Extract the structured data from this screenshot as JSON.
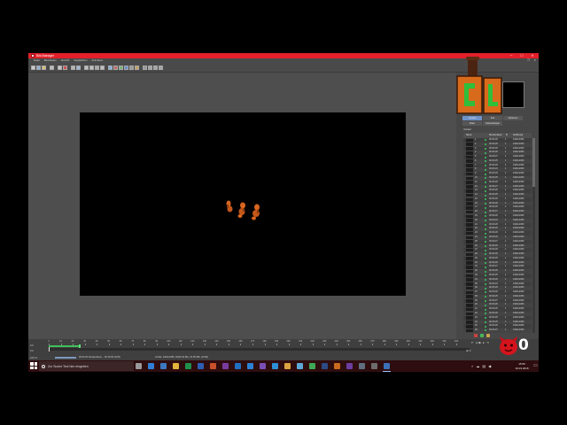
{
  "colors": {
    "titlebar": "#e3202a",
    "taskbar": "#2e0d0e",
    "active_tab": "#6f93c9",
    "status_ok": "#3ccb5c",
    "rendered_range": "#3fbf5a",
    "render_figure": "#d9661f"
  },
  "window": {
    "title": "Bild-Manager",
    "app_icon": "picture-viewer-icon",
    "minimize_glyph": "─",
    "maximize_glyph": "☐",
    "close_glyph": "✕"
  },
  "menu": {
    "items": [
      "Datei",
      "Bearbeiten",
      "Ansicht",
      "Vergleichen",
      "Animation"
    ],
    "restore_glyph": "❐",
    "close_glyph": "✕"
  },
  "toolbar": {
    "groups": [
      [
        {
          "name": "open-icon",
          "color": "#c9c9c9"
        },
        {
          "name": "save-icon",
          "color": "#8fb1d8"
        },
        {
          "name": "save-as-icon",
          "color": "#d8c27a"
        }
      ],
      [
        {
          "name": "info-icon",
          "color": "#bfbfbf"
        }
      ],
      [
        {
          "name": "copy-icon",
          "color": "#c6c6c6"
        },
        {
          "name": "stop-render-icon",
          "color": "#d05050"
        }
      ],
      [
        {
          "name": "zoom-fit-icon",
          "color": "#b5b5b5"
        },
        {
          "name": "zoom-100-icon",
          "color": "#9fb6d6"
        }
      ],
      [
        {
          "name": "compare-a-icon",
          "color": "#c0c0c0"
        },
        {
          "name": "compare-b-icon",
          "color": "#c0c0c0"
        },
        {
          "name": "swap-ab-icon",
          "color": "#a9a9a9"
        },
        {
          "name": "compare-split-icon",
          "color": "#c0c0c0"
        }
      ],
      [
        {
          "name": "rgb-icon",
          "color": "#7fb0e0"
        },
        {
          "name": "red-channel-icon",
          "color": "#c46a6a"
        },
        {
          "name": "green-channel-icon",
          "color": "#79b37a"
        },
        {
          "name": "blue-channel-icon",
          "color": "#6c8fc9"
        },
        {
          "name": "alpha-channel-icon",
          "color": "#9a9a9a"
        },
        {
          "name": "filter-icon",
          "color": "#c4a15e"
        }
      ],
      [
        {
          "name": "grid-icon",
          "color": "#9a9a9a"
        },
        {
          "name": "stereo-icon",
          "color": "#a5a5a5"
        },
        {
          "name": "histogram-icon",
          "color": "#a5a5a5"
        },
        {
          "name": "lut-icon",
          "color": "#a5a5a5"
        }
      ]
    ]
  },
  "panel": {
    "tabs_row1": [
      {
        "label": "Verlauf",
        "active": true
      },
      {
        "label": "Info"
      },
      {
        "label": "Optionen"
      }
    ],
    "tabs_row2": [
      {
        "label": "Filter"
      },
      {
        "label": "Stereoskopie"
      }
    ],
    "section_label": "Verlauf",
    "columns": {
      "name": "Name",
      "render_time": "Renderdauer",
      "b": "B",
      "resolution": "Auflösung"
    },
    "rows": [
      {
        "name": "1",
        "time": "00:00:26",
        "b": "1",
        "resolution": "1920x1080"
      },
      {
        "name": "2",
        "time": "00:00:25",
        "b": "1",
        "resolution": "1920x1080"
      },
      {
        "name": "3",
        "time": "00:00:26",
        "b": "1",
        "resolution": "1920x1080"
      },
      {
        "name": "4",
        "time": "00:00:26",
        "b": "1",
        "resolution": "1920x1080"
      },
      {
        "name": "5",
        "time": "00:00:27",
        "b": "1",
        "resolution": "1920x1080"
      },
      {
        "name": "6",
        "time": "00:00:25",
        "b": "1",
        "resolution": "1920x1080"
      },
      {
        "name": "7",
        "time": "00:00:26",
        "b": "1",
        "resolution": "1920x1080"
      },
      {
        "name": "8",
        "time": "00:00:24",
        "b": "1",
        "resolution": "1920x1080"
      },
      {
        "name": "9",
        "time": "00:00:26",
        "b": "1",
        "resolution": "1920x1080"
      },
      {
        "name": "10",
        "time": "00:00:25",
        "b": "1",
        "resolution": "1920x1080"
      },
      {
        "name": "11",
        "time": "00:00:26",
        "b": "1",
        "resolution": "1920x1080"
      },
      {
        "name": "12",
        "time": "00:00:27",
        "b": "1",
        "resolution": "1920x1080"
      },
      {
        "name": "13",
        "time": "00:00:26",
        "b": "1",
        "resolution": "1920x1080"
      },
      {
        "name": "14",
        "time": "00:00:25",
        "b": "1",
        "resolution": "1920x1080"
      },
      {
        "name": "15",
        "time": "00:00:26",
        "b": "1",
        "resolution": "1920x1080"
      },
      {
        "name": "16",
        "time": "00:00:26",
        "b": "1",
        "resolution": "1920x1080"
      },
      {
        "name": "17",
        "time": "00:00:25",
        "b": "1",
        "resolution": "1920x1080"
      },
      {
        "name": "18",
        "time": "00:00:27",
        "b": "1",
        "resolution": "1920x1080"
      },
      {
        "name": "19",
        "time": "00:00:26",
        "b": "1",
        "resolution": "1920x1080"
      },
      {
        "name": "20",
        "time": "00:00:24",
        "b": "1",
        "resolution": "1920x1080"
      },
      {
        "name": "21",
        "time": "00:00:26",
        "b": "1",
        "resolution": "1920x1080"
      },
      {
        "name": "22",
        "time": "00:00:25",
        "b": "1",
        "resolution": "1920x1080"
      },
      {
        "name": "23",
        "time": "00:00:26",
        "b": "1",
        "resolution": "1920x1080"
      },
      {
        "name": "24",
        "time": "00:00:26",
        "b": "1",
        "resolution": "1920x1080"
      },
      {
        "name": "25",
        "time": "00:00:27",
        "b": "1",
        "resolution": "1920x1080"
      },
      {
        "name": "26",
        "time": "00:00:25",
        "b": "1",
        "resolution": "1920x1080"
      },
      {
        "name": "27",
        "time": "00:00:26",
        "b": "1",
        "resolution": "1920x1080"
      },
      {
        "name": "28",
        "time": "00:00:26",
        "b": "1",
        "resolution": "1920x1080"
      },
      {
        "name": "29",
        "time": "00:00:25",
        "b": "1",
        "resolution": "1920x1080"
      },
      {
        "name": "30",
        "time": "00:00:26",
        "b": "1",
        "resolution": "1920x1080"
      },
      {
        "name": "31",
        "time": "00:00:27",
        "b": "1",
        "resolution": "1920x1080"
      },
      {
        "name": "32",
        "time": "00:00:26",
        "b": "1",
        "resolution": "1920x1080"
      },
      {
        "name": "33",
        "time": "00:00:25",
        "b": "1",
        "resolution": "1920x1080"
      },
      {
        "name": "34",
        "time": "00:00:26",
        "b": "1",
        "resolution": "1920x1080"
      },
      {
        "name": "35",
        "time": "00:00:24",
        "b": "1",
        "resolution": "1920x1080"
      },
      {
        "name": "36",
        "time": "00:00:26",
        "b": "1",
        "resolution": "1920x1080"
      },
      {
        "name": "37",
        "time": "00:00:26",
        "b": "1",
        "resolution": "1920x1080"
      },
      {
        "name": "38",
        "time": "00:00:25",
        "b": "1",
        "resolution": "1920x1080"
      },
      {
        "name": "39",
        "time": "00:00:27",
        "b": "1",
        "resolution": "1920x1080"
      },
      {
        "name": "40",
        "time": "00:00:26",
        "b": "1",
        "resolution": "1920x1080"
      },
      {
        "name": "41",
        "time": "00:00:25",
        "b": "1",
        "resolution": "1920x1080"
      },
      {
        "name": "42",
        "time": "00:00:26",
        "b": "1",
        "resolution": "1920x1080"
      },
      {
        "name": "43",
        "time": "00:00:26",
        "b": "1",
        "resolution": "1920x1080"
      },
      {
        "name": "44",
        "time": "00:00:25",
        "b": "1",
        "resolution": "1920x1080"
      },
      {
        "name": "45",
        "time": "00:00:26",
        "b": "1",
        "resolution": "1920x1080"
      },
      {
        "name": "46",
        "time": "00:00:27",
        "b": "1",
        "resolution": "1920x1080"
      }
    ],
    "footer_icons": [
      {
        "name": "delete-icon",
        "color": "#d04040"
      },
      {
        "name": "refresh-icon",
        "color": "#48b85c"
      },
      {
        "name": "star-icon",
        "color": "#c9a44a"
      }
    ]
  },
  "timeline": {
    "frame_start": "0 F",
    "frame_current": "0 F",
    "zoom": "100 %",
    "frame_end": "90 F",
    "ticks": [
      "0",
      "10",
      "20",
      "30",
      "40",
      "50",
      "60",
      "70",
      "80",
      "90",
      "100",
      "110",
      "120",
      "130",
      "140",
      "150",
      "160",
      "170",
      "180",
      "190",
      "200",
      "210",
      "220",
      "230",
      "240",
      "250",
      "260",
      "270",
      "280",
      "290",
      "300",
      "310",
      "320",
      "330",
      "340"
    ],
    "rendered_range": [
      0,
      26
    ],
    "current_frame": 0,
    "playback_icons": [
      "skip-start-icon",
      "step-back-icon",
      "play-icon",
      "step-forward-icon",
      "skip-end-icon"
    ]
  },
  "status": {
    "progress": 1,
    "render_text": "00:00:26 Renderdauer – 00:19:09 (49 B)",
    "size_text": "Größe: 1920x1080, RGB (32 Bit), 23,95 MB, (16 Bit)"
  },
  "overlay": {
    "logo_text": "0"
  },
  "taskbar": {
    "search_placeholder": "Zur Suche Text hier eingeben",
    "apps": [
      {
        "name": "task-view-icon",
        "color": "#9a9a9a"
      },
      {
        "name": "edge-icon",
        "color": "#2f7fd6"
      },
      {
        "name": "store-icon",
        "color": "#3b78c2"
      },
      {
        "name": "explorer-icon",
        "color": "#e3b23c"
      },
      {
        "name": "excel-icon",
        "color": "#1f8f4a"
      },
      {
        "name": "word-icon",
        "color": "#2b5fb4"
      },
      {
        "name": "powerpoint-icon",
        "color": "#c9502a"
      },
      {
        "name": "onenote-icon",
        "color": "#7a3ba0"
      },
      {
        "name": "outlook-icon",
        "color": "#1f6fc2"
      },
      {
        "name": "mail-icon",
        "color": "#2a82d4"
      },
      {
        "name": "visual-studio-icon",
        "color": "#7b4fb8"
      },
      {
        "name": "vs-code-icon",
        "color": "#2c8fd6"
      },
      {
        "name": "folder-icon",
        "color": "#d9a441"
      },
      {
        "name": "notepad-icon",
        "color": "#5aa9d8"
      },
      {
        "name": "chrome-icon",
        "color": "#3fa856"
      },
      {
        "name": "photoshop-icon",
        "color": "#2c4a86"
      },
      {
        "name": "illustrator-icon",
        "color": "#c96a1e"
      },
      {
        "name": "premiere-icon",
        "color": "#6b3ea0"
      },
      {
        "name": "network-app-icon",
        "color": "#5f6f80"
      },
      {
        "name": "calculator-icon",
        "color": "#6d6d6d"
      },
      {
        "name": "cinema4d-icon",
        "color": "#3b6fb8",
        "active": true
      }
    ],
    "tray_icons": [
      "chevron-up-icon",
      "onedrive-icon",
      "network-icon",
      "volume-icon"
    ],
    "time": "15:59",
    "date": "16.03.2018",
    "notification_icon": "notification-icon"
  }
}
